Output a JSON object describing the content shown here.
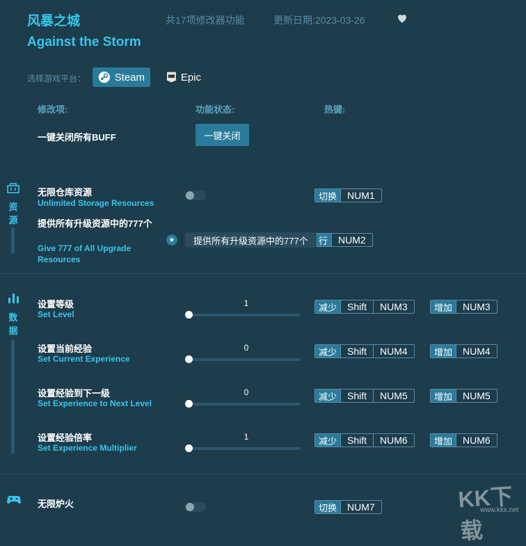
{
  "header": {
    "title_cn": "风暴之城",
    "title_en": "Against the Storm",
    "feature_count": "共17项修改器功能",
    "update_date": "更新日期:2023-03-26"
  },
  "platform": {
    "label": "选择游戏平台：",
    "options": [
      {
        "label": "Steam",
        "icon": "steam-icon",
        "selected": true
      },
      {
        "label": "Epic",
        "icon": "epic-icon",
        "selected": false
      }
    ]
  },
  "columns": {
    "item": "修改项:",
    "status": "功能状态:",
    "hotkey": "热键:"
  },
  "global": {
    "label": "一键关闭所有BUFF",
    "button": "一键关闭"
  },
  "sections": {
    "resources": {
      "title": "资源",
      "icon": "toolbox-icon"
    },
    "data": {
      "title": "数据",
      "icon": "bar-chart-icon"
    },
    "game": {
      "icon": "gamepad-icon"
    }
  },
  "resources": [
    {
      "cn": "无限仓库资源",
      "en": "Unlimited Storage Resources",
      "action": "切换",
      "key": "NUM1",
      "enabled": false
    },
    {
      "cn": "提供所有升级资源中的777个",
      "en": "Give 777 of All Upgrade Resources",
      "action": "行",
      "key": "NUM2",
      "tooltip": "提供所有升级资源中的777个"
    }
  ],
  "data_items": [
    {
      "cn": "设置等级",
      "en": "Set Level",
      "value": "1",
      "dec_action": "减少",
      "inc_action": "增加",
      "mod": "Shift",
      "key": "NUM3"
    },
    {
      "cn": "设置当前经验",
      "en": "Set Current Experience",
      "value": "0",
      "dec_action": "减少",
      "inc_action": "增加",
      "mod": "Shift",
      "key": "NUM4"
    },
    {
      "cn": "设置经验到下一级",
      "en": "Set Experience to Next Level",
      "value": "0",
      "dec_action": "减少",
      "inc_action": "增加",
      "mod": "Shift",
      "key": "NUM5"
    },
    {
      "cn": "设置经验倍率",
      "en": "Set Experience Multiplier",
      "value": "1",
      "dec_action": "减少",
      "inc_action": "增加",
      "mod": "Shift",
      "key": "NUM6"
    }
  ],
  "game_items": [
    {
      "cn": "无限炉火",
      "action": "切换",
      "key": "NUM7",
      "enabled": false
    }
  ],
  "watermark": {
    "text": "KK下载",
    "url": "www.kkx.net"
  },
  "colors": {
    "accent": "#36c6ea",
    "button": "#2a7b9b",
    "background": "#1d3c4c"
  }
}
